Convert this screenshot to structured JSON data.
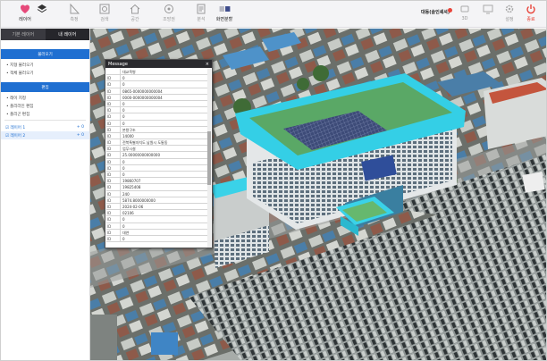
{
  "toolbar": {
    "items": [
      {
        "label": "레이어",
        "icon": "layers-icon"
      },
      {
        "label": "측정",
        "icon": "ruler-icon"
      },
      {
        "label": "검색",
        "icon": "search-icon"
      },
      {
        "label": "공간",
        "icon": "home-icon"
      },
      {
        "label": "조망권",
        "icon": "view-icon"
      },
      {
        "label": "분석",
        "icon": "document-icon"
      },
      {
        "label": "화면분할",
        "icon": "split-screen-icon"
      }
    ],
    "user_name": "대동(솔인셰셔)",
    "right_items": [
      {
        "label": "3D",
        "icon": "3d-icon"
      },
      {
        "label": "",
        "icon": "monitor-icon"
      },
      {
        "label": "설정",
        "icon": "gear-icon"
      },
      {
        "label": "종료",
        "icon": "power-icon"
      }
    ],
    "accent": "#e8443a",
    "brand": "#e64a7a"
  },
  "sidebar": {
    "tabs": [
      "기본 레이어",
      "내 레이어"
    ],
    "section1_title": "불러오기",
    "section1_items": [
      "• 지형 불러오기",
      "• 객체 불러오기"
    ],
    "section2_title": "편집",
    "section2_items": [
      "• 레이 지정",
      "• 폴리라인 편집",
      "• 폴리곤 편집"
    ],
    "layers": [
      {
        "name": "☑ 레이어 1",
        "badge": "+ 0"
      },
      {
        "name": "☑ 레이어 2",
        "badge": "+ 0"
      }
    ],
    "accent": "#1f6fd1"
  },
  "popup": {
    "title": "Message",
    "close": "×",
    "rows": [
      {
        "k": "",
        "v": "대교목병"
      },
      {
        "k": "ID",
        "v": "0"
      },
      {
        "k": "ID",
        "v": "0"
      },
      {
        "k": "ID",
        "v": "0865-0000000000004"
      },
      {
        "k": "ID",
        "v": "0000-0000000000004"
      },
      {
        "k": "ID",
        "v": "0"
      },
      {
        "k": "ID",
        "v": "0"
      },
      {
        "k": "ID",
        "v": "0"
      },
      {
        "k": "ID",
        "v": "0"
      },
      {
        "k": "ID",
        "v": "본왕구조"
      },
      {
        "k": "ID",
        "v": "14000"
      },
      {
        "k": "ID",
        "v": "전북특별자치도 남원시 도통동"
      },
      {
        "k": "ID",
        "v": "업무시설"
      },
      {
        "k": "ID",
        "v": "25.00000000000000"
      },
      {
        "k": "ID",
        "v": "0"
      },
      {
        "k": "ID",
        "v": "0"
      },
      {
        "k": "ID",
        "v": "0"
      },
      {
        "k": "ID",
        "v": "19860707"
      },
      {
        "k": "ID",
        "v": "19825408"
      },
      {
        "k": "ID",
        "v": "240"
      },
      {
        "k": "ID",
        "v": "5874.8000000000"
      },
      {
        "k": "ID",
        "v": "2024-02-06"
      },
      {
        "k": "ID",
        "v": "02106"
      },
      {
        "k": "ID",
        "v": "0"
      },
      {
        "k": "ID",
        "v": "0"
      },
      {
        "k": "ID",
        "v": "대연"
      },
      {
        "k": "ID",
        "v": "0"
      }
    ]
  }
}
